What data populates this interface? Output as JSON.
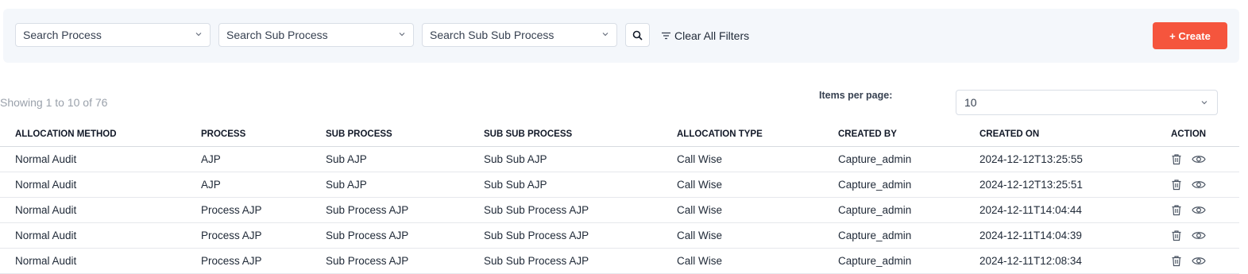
{
  "filters": {
    "process_placeholder": "Search Process",
    "sub_process_placeholder": "Search Sub Process",
    "sub_sub_process_placeholder": "Search Sub Sub Process",
    "clear_label": "Clear All Filters",
    "create_label": "+ Create"
  },
  "pagination": {
    "showing_text": "Showing 1 to 10 of 76",
    "items_per_page_label": "Items per page:",
    "items_per_page_value": "10"
  },
  "table": {
    "columns": [
      "ALLOCATION METHOD",
      "PROCESS",
      "SUB PROCESS",
      "SUB SUB PROCESS",
      "ALLOCATION TYPE",
      "CREATED BY",
      "CREATED ON",
      "ACTION"
    ],
    "rows": [
      [
        "Normal Audit",
        "AJP",
        "Sub AJP",
        "Sub Sub AJP",
        "Call Wise",
        "Capture_admin",
        "2024-12-12T13:25:55"
      ],
      [
        "Normal Audit",
        "AJP",
        "Sub AJP",
        "Sub Sub AJP",
        "Call Wise",
        "Capture_admin",
        "2024-12-12T13:25:51"
      ],
      [
        "Normal Audit",
        "Process AJP",
        "Sub Process AJP",
        "Sub Sub Process AJP",
        "Call Wise",
        "Capture_admin",
        "2024-12-11T14:04:44"
      ],
      [
        "Normal Audit",
        "Process AJP",
        "Sub Process AJP",
        "Sub Sub Process AJP",
        "Call Wise",
        "Capture_admin",
        "2024-12-11T14:04:39"
      ],
      [
        "Normal Audit",
        "Process AJP",
        "Sub Process AJP",
        "Sub Sub Process AJP",
        "Call Wise",
        "Capture_admin",
        "2024-12-11T12:08:34"
      ]
    ],
    "action_icons": [
      "trash-icon",
      "eye-icon"
    ]
  },
  "colors": {
    "accent": "#f5553d",
    "filter_bar_bg": "#f4f7fb",
    "muted_text": "#9aa1ab"
  }
}
